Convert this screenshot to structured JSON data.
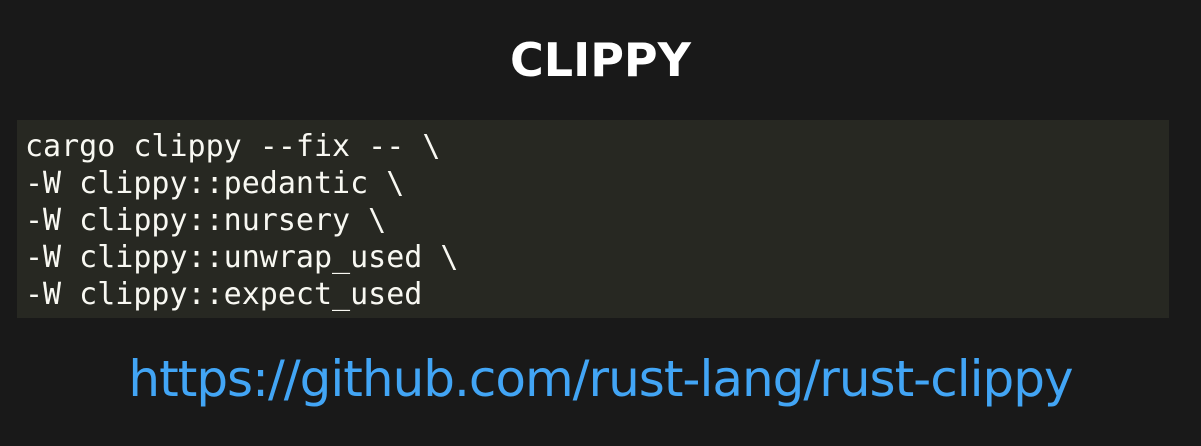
{
  "slide": {
    "title": "CLIPPY",
    "code_lines": [
      "cargo clippy --fix -- \\",
      "-W clippy::pedantic \\",
      "-W clippy::nursery \\",
      "-W clippy::unwrap_used \\",
      "-W clippy::expect_used"
    ],
    "link_text": "https://github.com/rust-lang/rust-clippy"
  },
  "colors": {
    "background": "#191919",
    "code_background": "#272822",
    "code_text": "#f8f8f2",
    "title_text": "#ffffff",
    "link": "#42a5f5"
  }
}
